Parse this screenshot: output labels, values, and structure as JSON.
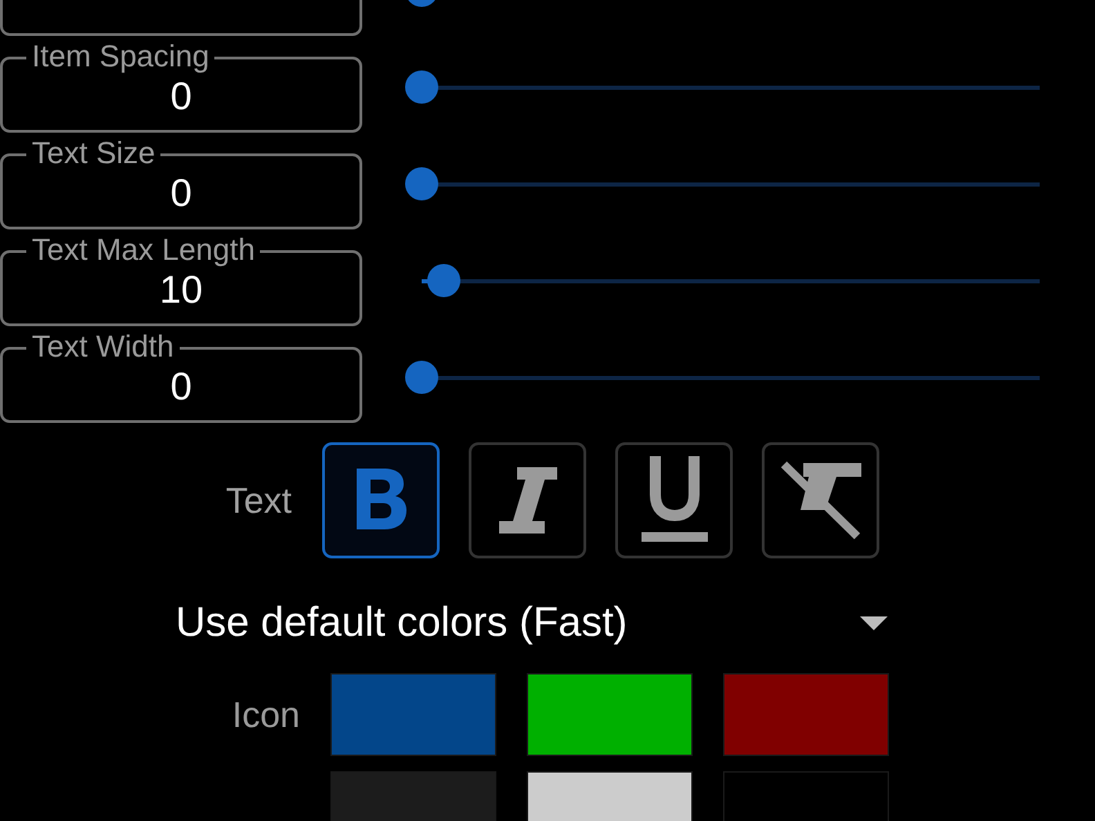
{
  "settings": [
    {
      "level": 0
    },
    {
      "label": "Item Spacing",
      "value": "0",
      "level": 0
    },
    {
      "label": "Text Size",
      "value": "0",
      "level": 0
    },
    {
      "label": "Text Max Length",
      "value": "10",
      "level": 0.036
    },
    {
      "label": "Text Width",
      "value": "0",
      "level": 0
    }
  ],
  "text_style": {
    "label": "Text",
    "buttons": [
      {
        "kind": "bold",
        "selected": true
      },
      {
        "kind": "italic",
        "selected": false
      },
      {
        "kind": "underline",
        "selected": false
      },
      {
        "kind": "clear",
        "selected": false
      }
    ]
  },
  "color_mode": {
    "value": "Use default colors (Fast)"
  },
  "color_rows": [
    {
      "label": "Icon",
      "swatches": [
        {
          "color": "#03468a"
        },
        {
          "color": "#00b000"
        },
        {
          "color": "#800000"
        }
      ]
    },
    {
      "swatches": [
        {
          "color": "#1c1c1c"
        },
        {
          "color": "#cccccc"
        },
        {
          "color": "#000000"
        }
      ]
    }
  ]
}
